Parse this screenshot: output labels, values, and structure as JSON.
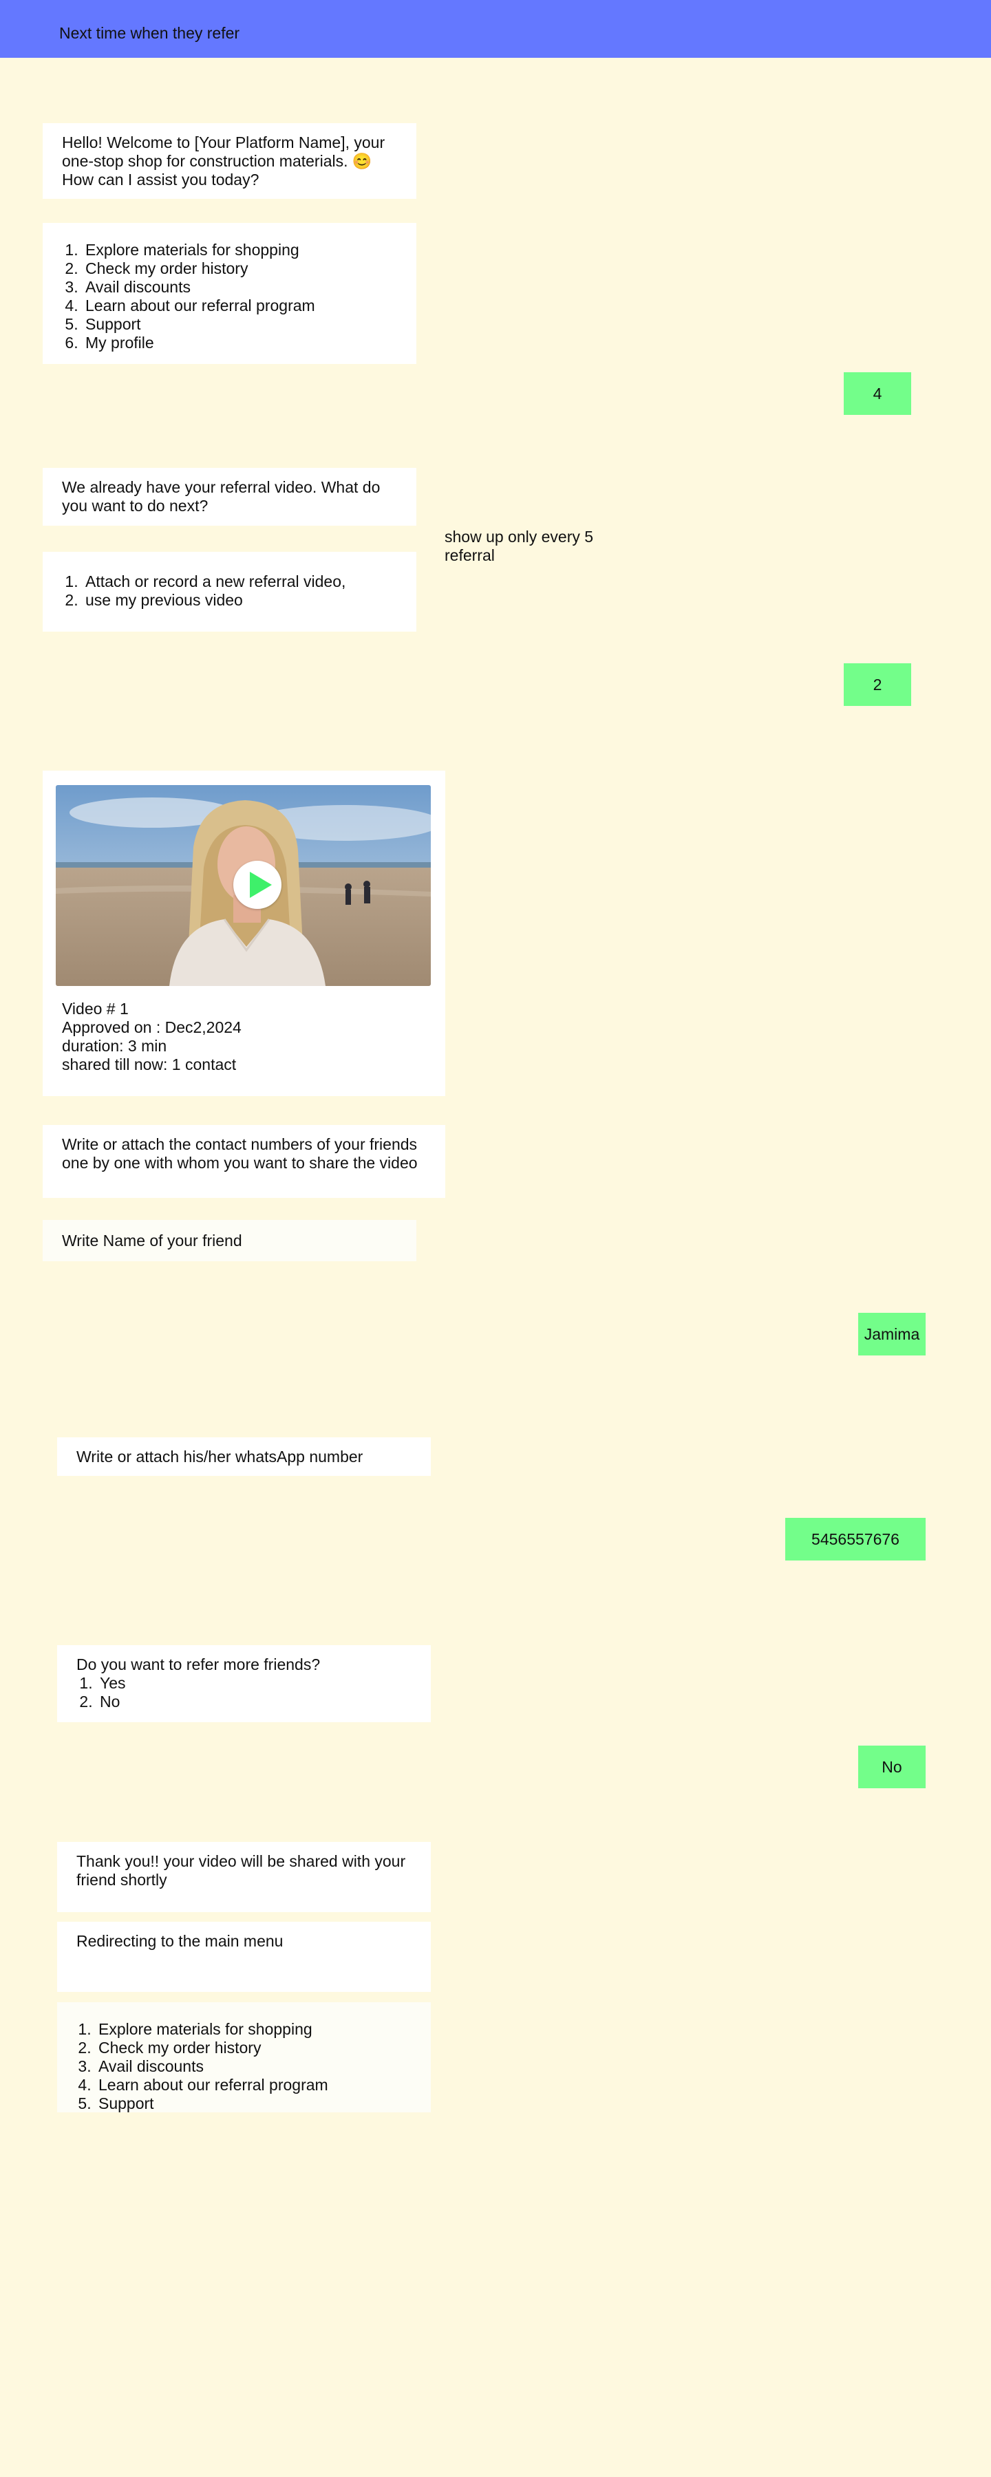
{
  "header": {
    "title": "Next time when they refer"
  },
  "messages": {
    "welcome": "Hello! Welcome to [Your Platform Name], your one-stop shop for construction materials. 😊 How can I assist you today?",
    "main_menu": [
      "Explore materials for shopping",
      "Check my order history",
      "Avail discounts",
      "Learn about our referral program",
      "Support",
      "My profile"
    ],
    "reply_menu_choice": "4",
    "already_have_video": "We already have your referral video. What do you want to do next?",
    "video_options": [
      "Attach or record a new referral video,",
      "use my previous video"
    ],
    "side_note": "show up only every 5 referral",
    "reply_video_choice": "2",
    "video_card": {
      "line1": "Video # 1",
      "line2": "Approved on : Dec2,2024",
      "line3": "duration: 3 min",
      "line4": "shared till now: 1 contact",
      "play_icon": "play-icon"
    },
    "write_contacts": "Write or attach the contact numbers of your friends one by one with whom you want to share the video",
    "write_name": "Write Name of your friend",
    "reply_name": "Jamima",
    "write_whatsapp": "Write or attach his/her whatsApp number",
    "reply_number": "5456557676",
    "refer_more": {
      "question": "Do you want to refer more friends?",
      "options": [
        "Yes",
        "No"
      ]
    },
    "reply_refer_more": "No",
    "thank_you": "Thank you!! your video will be shared with your friend shortly",
    "redirecting": "Redirecting to the main menu",
    "final_menu": [
      "Explore materials for shopping",
      "Check my order history",
      "Avail discounts",
      "Learn about our referral program",
      "Support"
    ]
  },
  "colors": {
    "background": "#fef9df",
    "header": "#6478ff",
    "bot_bubble": "#ffffff",
    "user_bubble": "#73fe8a",
    "play_triangle": "#3ef06a"
  }
}
